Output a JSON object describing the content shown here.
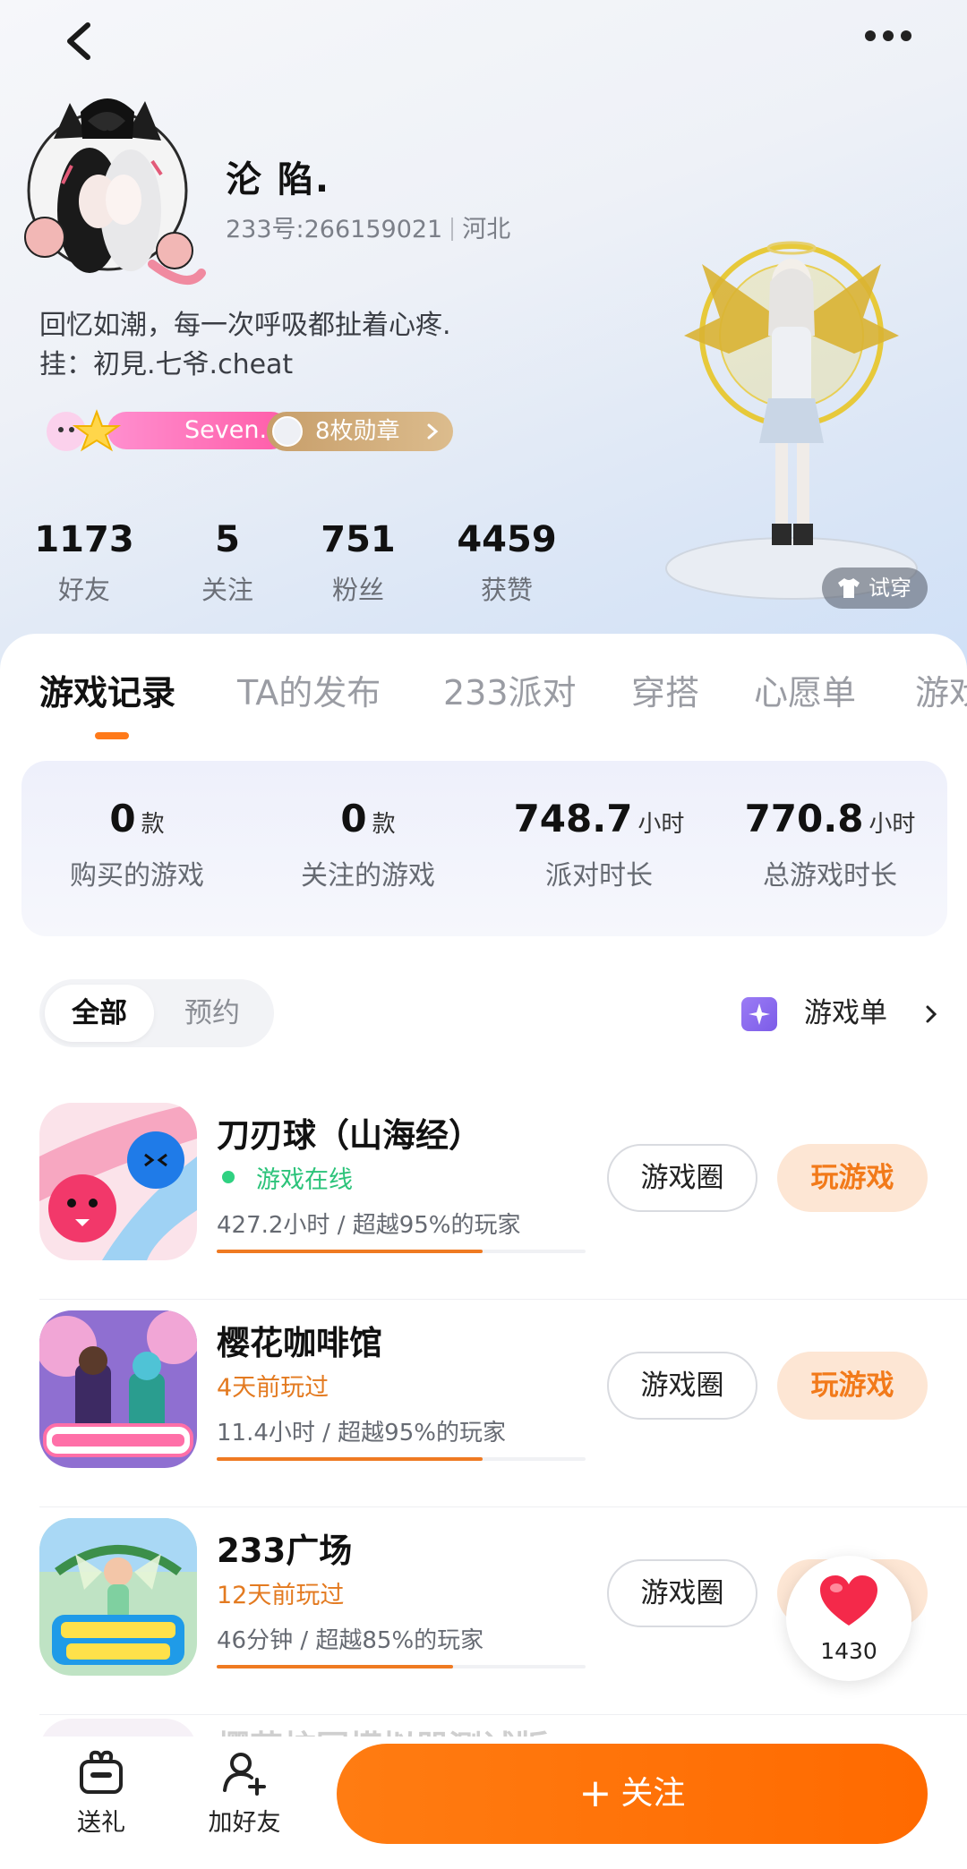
{
  "profile": {
    "nickname": "沦 陷.",
    "uid": "233号:266159021",
    "region": "河北",
    "bio_line1": "回忆如潮，每一次呼吸都扯着心疼.",
    "bio_line2": "挂：初見.七爷.cheat",
    "level_name": "Seven.",
    "medals_label": "8枚勋章",
    "tryon_label": "试穿"
  },
  "stats": [
    {
      "value": "1173",
      "label": "好友"
    },
    {
      "value": "5",
      "label": "关注"
    },
    {
      "value": "751",
      "label": "粉丝"
    },
    {
      "value": "4459",
      "label": "获赞"
    }
  ],
  "tabs": [
    "游戏记录",
    "TA的发布",
    "233派对",
    "穿搭",
    "心愿单",
    "游戏"
  ],
  "active_tab": "游戏记录",
  "summary": [
    {
      "value": "0",
      "unit": "款",
      "label": "购买的游戏"
    },
    {
      "value": "0",
      "unit": "款",
      "label": "关注的游戏"
    },
    {
      "value": "748.7",
      "unit": "小时",
      "label": "派对时长"
    },
    {
      "value": "770.8",
      "unit": "小时",
      "label": "总游戏时长"
    }
  ],
  "filter": {
    "all": "全部",
    "reserved": "预约"
  },
  "gamelist_label": "游戏单",
  "games": [
    {
      "title": "刀刃球（山海经）",
      "status": "游戏在线",
      "online": true,
      "time": "427.2小时 / 超越95%的玩家",
      "progress": 0.72,
      "circle": "游戏圈",
      "play": "玩游戏"
    },
    {
      "title": "樱花咖啡馆",
      "status": "4天前玩过",
      "online": false,
      "time": "11.4小时 / 超越95%的玩家",
      "progress": 0.72,
      "circle": "游戏圈",
      "play": "玩游戏"
    },
    {
      "title": "233广场",
      "status": "12天前玩过",
      "online": false,
      "time": "46分钟 / 超越85%的玩家",
      "progress": 0.64,
      "circle": "游戏圈",
      "play": "玩游戏"
    }
  ],
  "peek_title": "樱花校园模拟器测试版",
  "like_count": "1430",
  "bottom": {
    "gift": "送礼",
    "add_friend": "加好友",
    "follow": "关注"
  },
  "colors": {
    "accent": "#ff7a1a",
    "online": "#2fd181",
    "level_pink": "#ff5ca8",
    "medal_gold": "#c79e6a"
  }
}
